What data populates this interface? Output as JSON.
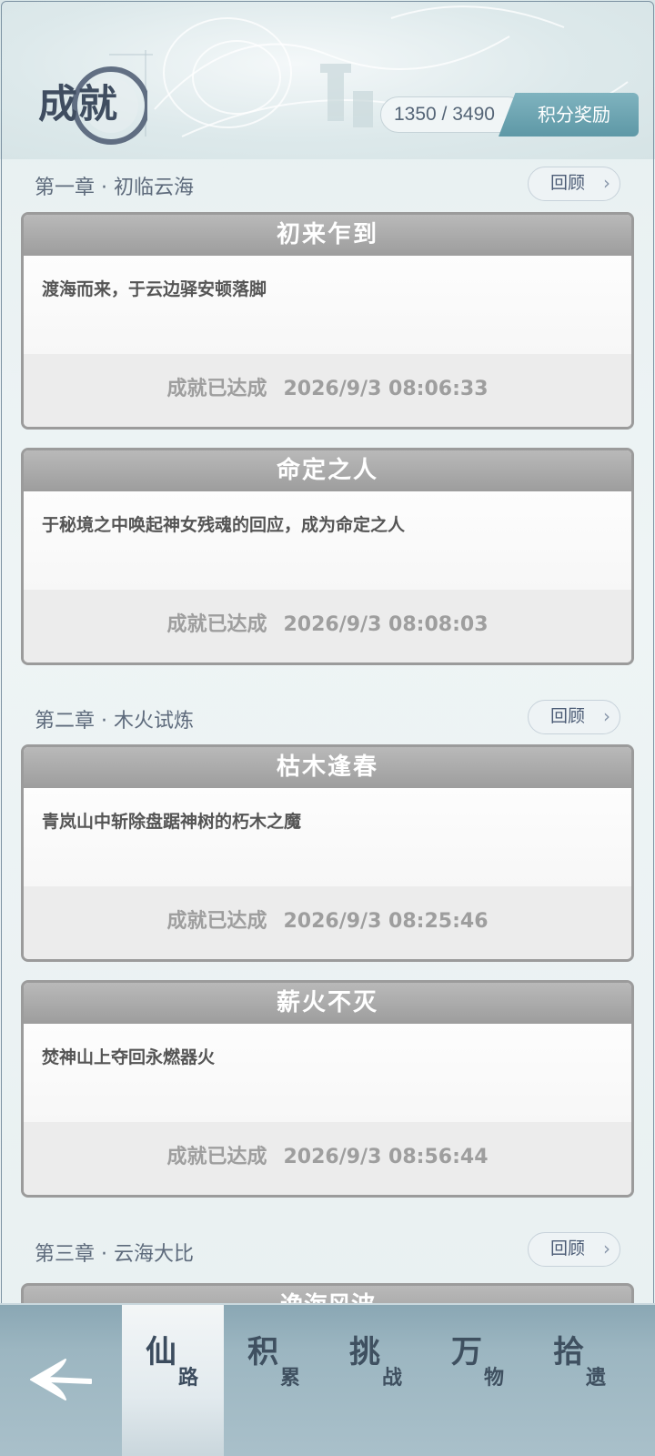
{
  "header": {
    "title": "成就",
    "score": "1350 / 3490",
    "reward_label": "积分奖励"
  },
  "chapters": [
    {
      "title": "第一章 · 初临云海",
      "review_label": "回顾",
      "achievements": [
        {
          "name": "初来乍到",
          "desc": "渡海而来，于云边驿安顿落脚",
          "status": "成就已达成",
          "time": "2026/9/3 08:06:33"
        },
        {
          "name": "命定之人",
          "desc": "于秘境之中唤起神女残魂的回应，成为命定之人",
          "status": "成就已达成",
          "time": "2026/9/3 08:08:03"
        }
      ]
    },
    {
      "title": "第二章 · 木火试炼",
      "review_label": "回顾",
      "achievements": [
        {
          "name": "枯木逢春",
          "desc": "青岚山中斩除盘踞神树的朽木之魔",
          "status": "成就已达成",
          "time": "2026/9/3 08:25:46"
        },
        {
          "name": "薪火不灭",
          "desc": "焚神山上夺回永燃器火",
          "status": "成就已达成",
          "time": "2026/9/3 08:56:44"
        }
      ]
    },
    {
      "title": "第三章 · 云海大比",
      "review_label": "回顾",
      "achievements": [
        {
          "name": "逸海风波"
        }
      ]
    }
  ],
  "nav": {
    "back_icon": "back-arrow-icon",
    "tabs": [
      {
        "big": "仙",
        "small": "路",
        "active": true
      },
      {
        "big": "积",
        "small": "累",
        "active": false
      },
      {
        "big": "挑",
        "small": "战",
        "active": false
      },
      {
        "big": "万",
        "small": "物",
        "active": false
      },
      {
        "big": "拾",
        "small": "遗",
        "active": false
      }
    ]
  },
  "colors": {
    "accent": "#6aa3b0",
    "card_header": "#a8a8a8",
    "nav_bg": "#9cb6c1",
    "text_title": "#3f4d60"
  }
}
